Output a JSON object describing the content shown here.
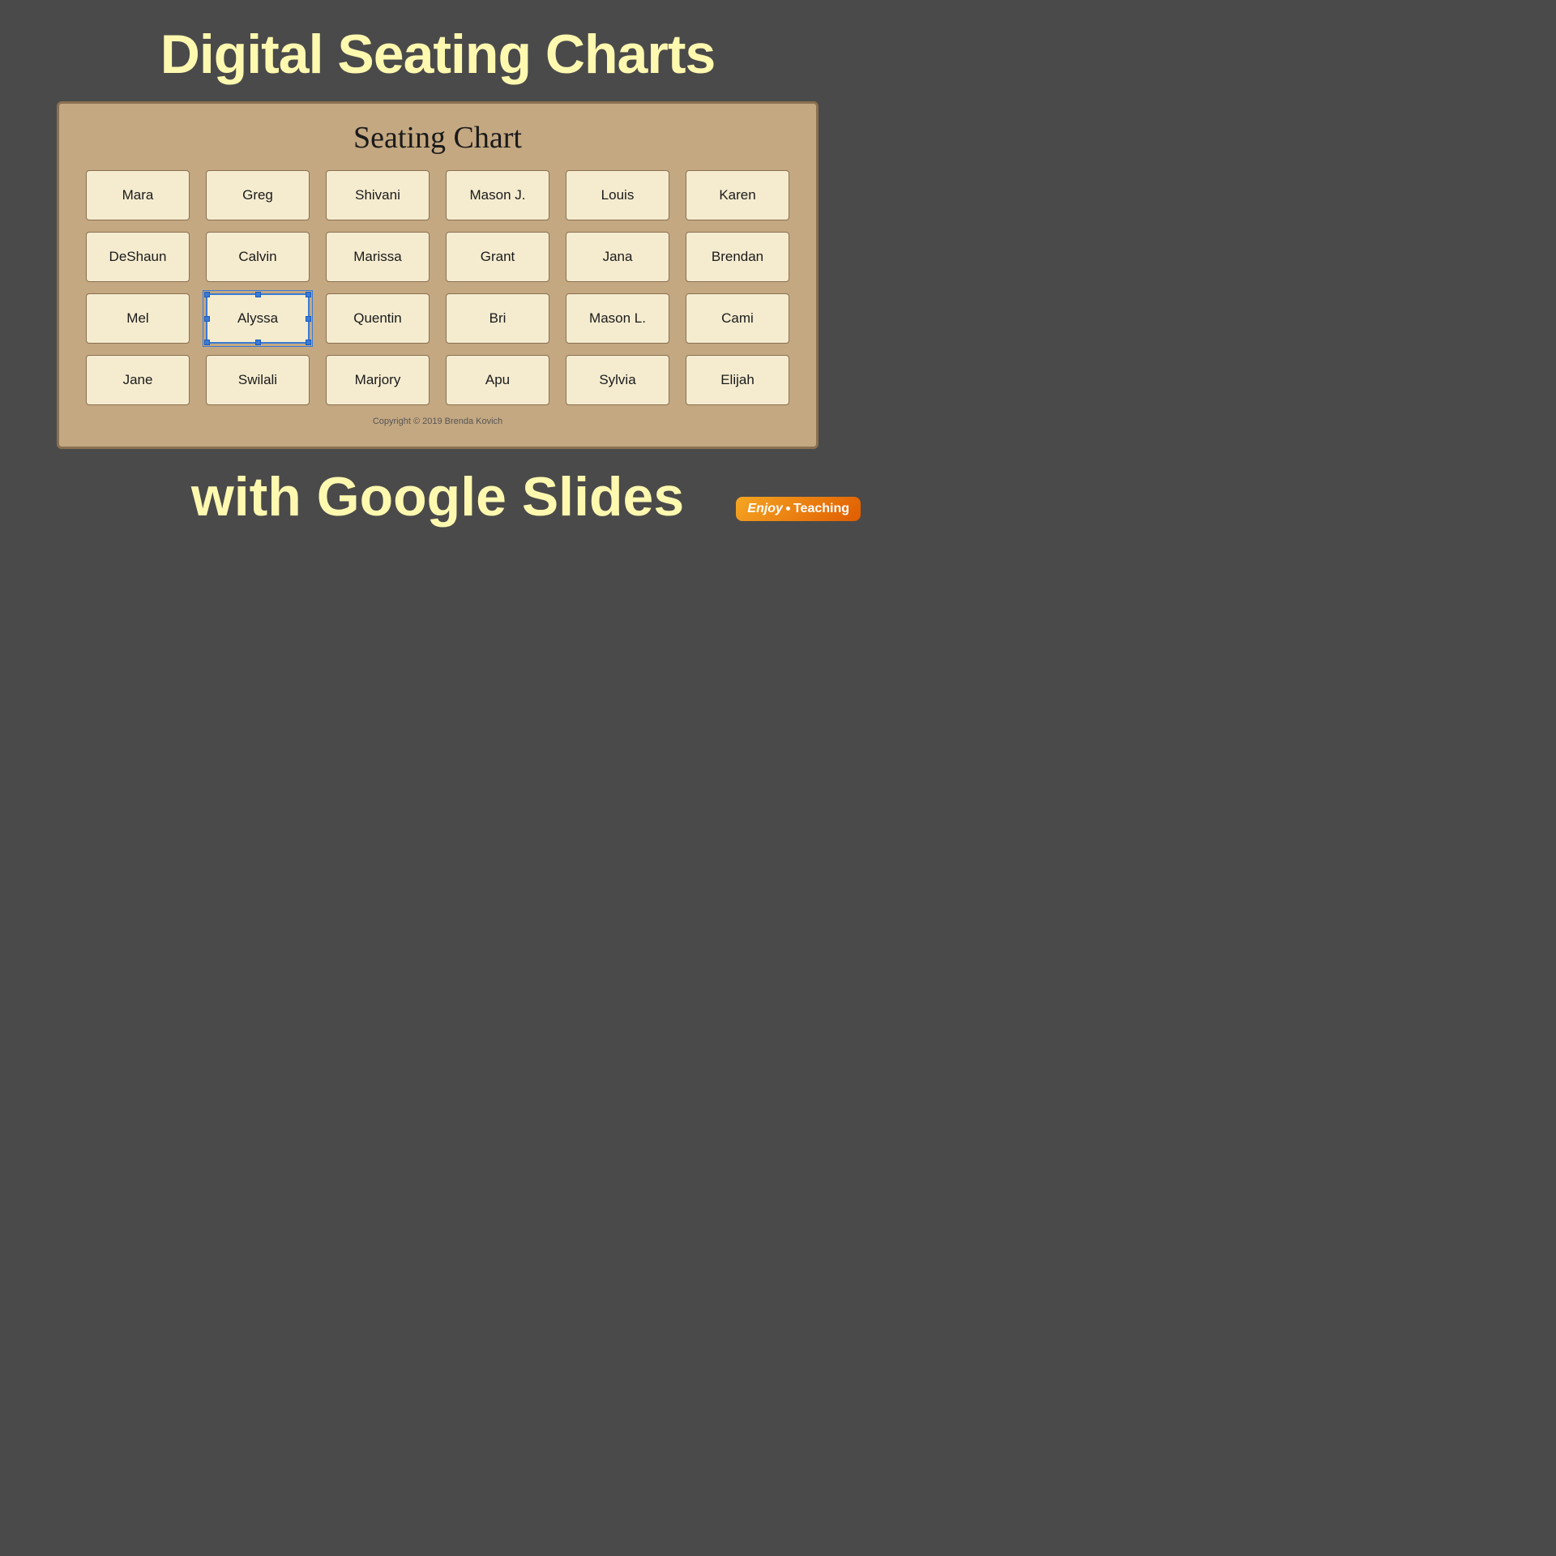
{
  "page": {
    "background_color": "#4a4a4a",
    "top_title": "Digital Seating Charts",
    "bottom_title": "with Google Slides",
    "title_color": "#fff9b0"
  },
  "chart": {
    "title": "Seating Chart",
    "background": "#c4a882",
    "border_color": "#8a7050",
    "copyright": "Copyright © 2019 Brenda Kovich",
    "rows": [
      [
        "Mara",
        "Greg",
        "Shivani",
        "Mason J.",
        "Louis",
        "Karen"
      ],
      [
        "DeShaun",
        "Calvin",
        "Marissa",
        "Grant",
        "Jana",
        "Brendan"
      ],
      [
        "Mel",
        "Alyssa",
        "Quentin",
        "Bri",
        "Mason L.",
        "Cami"
      ],
      [
        "Jane",
        "Swilali",
        "Marjory",
        "Apu",
        "Sylvia",
        "Elijah"
      ]
    ],
    "selected_seat": "Alyssa"
  },
  "brand": {
    "enjoy": "Enjoy",
    "teaching": "Teaching"
  }
}
